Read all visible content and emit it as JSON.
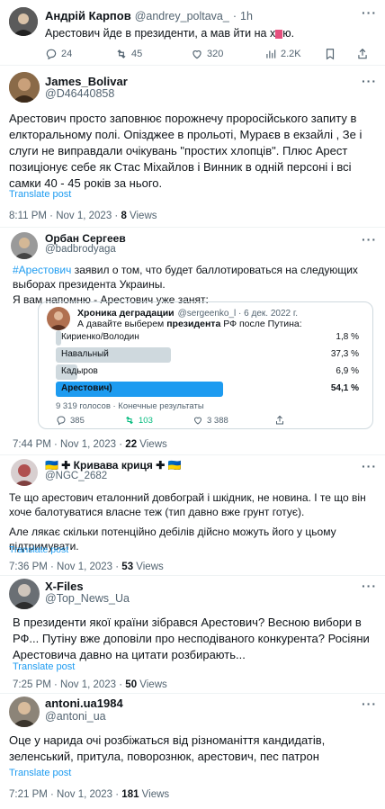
{
  "top_tweet": {
    "name": "Андрій Карпов",
    "handle": "@andrey_poltava_",
    "sep": "·",
    "time": "1h",
    "text": "Арестович йде в президенти, а мав йти на х",
    "text_tail": "ю.",
    "actions": {
      "replies": "24",
      "retweets": "45",
      "likes": "320",
      "views": "2.2K"
    }
  },
  "tweets": [
    {
      "name": "James_Bolivar",
      "handle": "@D46440858",
      "text": "Арестович просто заповнює порожнечу проросійського запиту в елкторальному полі. Опізджее в прольоті, Мураєв в екзайлі , Зе і слуги не виправдали очікувань \"простих хлопців\". Плюс Арест позиціонує себе як Стас Міхайлов і Винник в одній персоні і всі самки 40 - 45 років за нього.",
      "translate": "Translate post",
      "time": "8:11 PM · Nov 1, 2023 · ",
      "views": "8",
      "views_label": " Views"
    },
    {
      "name": "Орбан Сергеев",
      "handle": "@badbrodyaga",
      "hashtag": "#Арестович",
      "text": " заявил о том, что будет баллотироваться на следующих выборах президента Украины.",
      "text2": "Я вам напомню - Арестович уже занят:",
      "time": "7:44 PM · Nov 1, 2023 · ",
      "views": "22",
      "views_label": " Views",
      "quote": {
        "name": "Хроника деградации",
        "handle": "@sergeenko_l · 6 дек. 2022 г.",
        "text_a": "А давайте выберем ",
        "text_b": "президента",
        "text_c": " РФ после Путина:",
        "options": [
          {
            "label": "Кириенко/Володин",
            "pct": "1,8 %",
            "value": 1.8
          },
          {
            "label": "Навальный",
            "pct": "37,3 %",
            "value": 37.3
          },
          {
            "label": "Кадыров",
            "pct": "6,9 %",
            "value": 6.9
          },
          {
            "label": "Арестович)",
            "pct": "54,1 %",
            "value": 54.1,
            "winner": true
          }
        ],
        "footer": "9 319 голосов · Конечные результаты",
        "actions": {
          "replies": "385",
          "retweets": "103",
          "likes": "3 388"
        }
      }
    },
    {
      "name": "🇺🇦 ✚ Кривава криця ✚ 🇺🇦",
      "handle": "@NGC_2682",
      "text": "Те що арестович еталонний довбограй і шкідник, не новина. І те що він хоче балотуватися власне теж (тип давно вже грунт готує).",
      "text2": "Але лякає скільки потенційно дебілів дійсно можуть його у цьому підтримувати.",
      "translate": "Translate post",
      "time": "7:36 PM · Nov 1, 2023 · ",
      "views": "53",
      "views_label": " Views"
    },
    {
      "name": "X-Files",
      "handle": "@Top_News_Ua",
      "text": "В президенти якої країни зібрався Арестович? Весною вибори в РФ... Путіну вже доповіли про несподіваного конкурента? Росіяни Арестовича давно на цитати розбирають...",
      "translate": "Translate post",
      "time": "7:25 PM · Nov 1, 2023 · ",
      "views": "50",
      "views_label": " Views"
    },
    {
      "name": "antoni.ua1984",
      "handle": "@antoni_ua",
      "text": "Оце у нарида очі розбіжаться від різноманіття кандидатів, зеленський, притула, поворознюк, арестович, пес патрон",
      "translate": "Translate post",
      "time": "7:21 PM · Nov 1, 2023 · ",
      "views": "181",
      "views_label": " Views"
    }
  ],
  "colors": {
    "accent": "#1d9bf0",
    "text": "#0f1419",
    "muted": "#536471",
    "poll_winner": "#1d9bf0",
    "poll_bar": "#cfd9de"
  }
}
